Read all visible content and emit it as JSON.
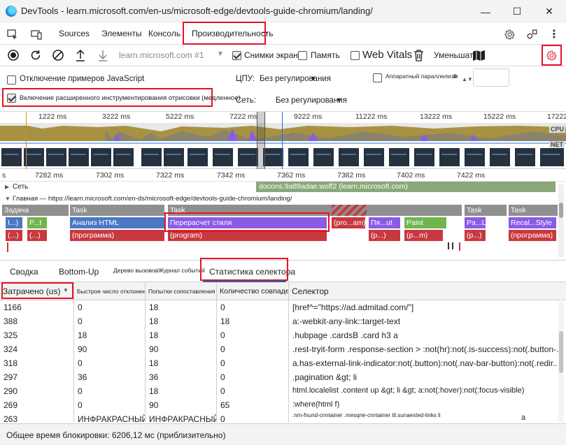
{
  "window": {
    "title": "DevTools - learn.microsoft.com/en-us/microsoft-edge/devtools-guide-chromium/landing/",
    "minimize": "—",
    "maximize": "☐",
    "close": "✕"
  },
  "tabs": {
    "sources": "Sources",
    "elements": "Элементы",
    "console": "Консоль",
    "performance": "Производительность",
    "add": "+"
  },
  "toolbar": {
    "profile_select": "learn.microsoft.com #1",
    "screenshots_label": "Снимки экрана",
    "memory_label": "Память",
    "web_vitals_label": "Web Vitals",
    "zoom_label": "Уменьшат"
  },
  "settings": {
    "disable_js_samples": "Отключение примеров JavaScript",
    "enable_paint_instrumentation": "Включение расширенного инструментирования отрисовки (медленное)",
    "cpu_label": "ЦПУ:",
    "cpu_value": "Без регулирования",
    "network_label": "Сеть:",
    "network_value": "Без регулирования",
    "hw_concurrency_label": "Аппаратный параллелизм",
    "hw_concurrency_value": "8"
  },
  "overview": {
    "ruler": [
      "1222 ms",
      "3222 ms",
      "5222 ms",
      "7222 ms",
      "9222 ms",
      "11222 ms",
      "13222 ms",
      "15222 ms",
      "17222"
    ],
    "cpu_label": "CPU",
    "net_label": "NET"
  },
  "flame": {
    "ruler": [
      "s",
      "7282 ms",
      "7302 ms",
      "7322 ms",
      "7342 ms",
      "7362 ms",
      "7382 ms",
      "7402 ms",
      "7422 ms"
    ],
    "network_track": "Сеть",
    "network_request": "docons.9a89adae.woff2 (learn.microsoft.com)",
    "main_track": "Главная — https://learn.microsoft.com/en-ds/microsoft-edge/devtools-guide-chromium/landing/",
    "task_labels": [
      "Задача",
      "Task",
      "Task",
      "Task",
      "Task"
    ],
    "row2": [
      "I...)",
      "P...t",
      "Анализ HTML",
      "Перерасчет стиля",
      "(pro...am)",
      "Пя...ut",
      "Paint",
      "Pa...L",
      "Recal...Style"
    ],
    "row3": [
      "(...)",
      "(...)",
      "(программа)",
      "(program)",
      "(p...)",
      "(p...m)",
      "(p...)",
      "(программа)"
    ]
  },
  "bottom_tabs": {
    "summary": "Сводка",
    "bottom_up": "Bottom-Up",
    "call_tree": "Дерево вызовов",
    "event_log": "Журнал событий",
    "selector_stats": "Статистика селектора"
  },
  "table": {
    "headers": [
      "Затрачено (us)",
      "Быстрое число отклонений",
      "Попытки сопоставления",
      "Количество совпадений",
      "Селектор"
    ],
    "rows": [
      [
        "1166",
        "0",
        "18",
        "0",
        "[href^=\"https://ad.admitad.com/\"]"
      ],
      [
        "388",
        "0",
        "18",
        "18",
        "a:-webkit-any-link::target-text"
      ],
      [
        "325",
        "18",
        "18",
        "0",
        ".hubpage .cardsB .card h3 a"
      ],
      [
        "324",
        "90",
        "90",
        "0",
        ".rest-tryit-form .response-section > :not(hr):not(.is-success):not(.button-..."
      ],
      [
        "318",
        "0",
        "18",
        "0",
        "a.has-external-link-indicator:not(.button):not(.nav-bar-button):not(.redir..."
      ],
      [
        "297",
        "36",
        "36",
        "0",
        ".pagination &gt; li"
      ],
      [
        "290",
        "0",
        "18",
        "0",
        "html.localelist .content up &gt; li &gt; a:not(:hover):not(:focus-visible)"
      ],
      [
        "269",
        "0",
        "90",
        "65",
        ":where(html f)"
      ],
      [
        "263",
        "ИНФРАКРАСНЫЙ",
        "ИНФРАКРАСНЫЙ",
        "0",
        ".nm-fnund-cnntainer .mesqne-cnntainer til.sunaested-links li"
      ]
    ],
    "trailing_a": "a"
  },
  "status": {
    "text": "Общее время блокировки: 6206,12 мс (приблизительно)"
  },
  "colors": {
    "highlight": "#e81123",
    "task_gray": "#8f8f8f",
    "html_blue": "#4a78c5",
    "style_purple": "#8a5ce6",
    "program_red": "#c8383f",
    "paint_green": "#6fb64f",
    "network_green": "#8aa87a"
  }
}
